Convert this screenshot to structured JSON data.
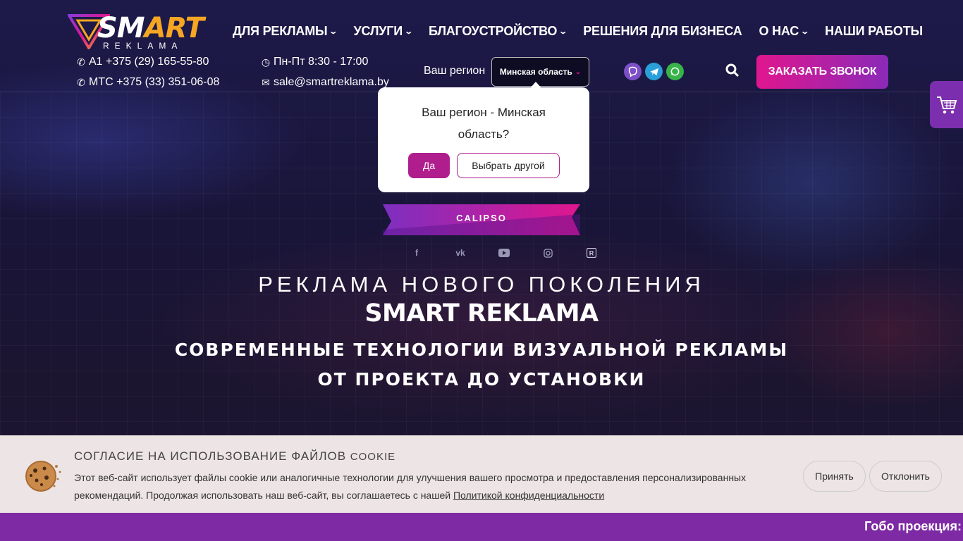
{
  "brand": {
    "logo_main_a": "SM",
    "logo_main_b": "ART",
    "logo_sub": "REKLAMA"
  },
  "nav": [
    {
      "label": "ДЛЯ РЕКЛАМЫ",
      "has_dropdown": true
    },
    {
      "label": "УСЛУГИ",
      "has_dropdown": true
    },
    {
      "label": "БЛАГОУСТРОЙСТВО",
      "has_dropdown": true
    },
    {
      "label": "РЕШЕНИЯ ДЛЯ БИЗНЕСА",
      "has_dropdown": false
    },
    {
      "label": "О НАС",
      "has_dropdown": true
    },
    {
      "label": "НАШИ РАБОТЫ",
      "has_dropdown": false
    }
  ],
  "contacts": {
    "phone_a1": "A1 +375 (29) 165-55-80",
    "phone_mts": "МТС +375 (33) 351-06-08",
    "hours": "Пн-Пт 8:30 - 17:00",
    "email": "sale@smartreklama.by"
  },
  "region": {
    "label": "Ваш регион",
    "selected": "Минская область"
  },
  "messengers": [
    "viber-icon",
    "telegram-icon",
    "whatsapp-icon"
  ],
  "call_button": "ЗАКАЗАТЬ ЗВОНОК",
  "popup": {
    "text": "Ваш регион - Минская область?",
    "yes": "Да",
    "other": "Выбрать другой"
  },
  "hero": {
    "ribbon": "CALIPSO",
    "socials": [
      "facebook-icon",
      "vk-icon",
      "youtube-icon",
      "instagram-icon",
      "rutube-icon"
    ],
    "line1": "РЕКЛАМА НОВОГО ПОКОЛЕНИЯ",
    "line2": "SMART REKLAMA",
    "line3": "СОВРЕМЕННЫЕ ТЕХНОЛОГИИ ВИЗУАЛЬНОЙ РЕКЛАМЫ",
    "line4": "ОТ ПРОЕКТА ДО УСТАНОВКИ"
  },
  "cookie": {
    "title": "СОГЛАСИЕ НА ИСПОЛЬЗОВАНИЕ ФАЙЛОВ",
    "title_suffix": "COOKIE",
    "text": "Этот веб-сайт использует файлы cookie или аналогичные технологии для улучшения вашего просмотра и предоставления персонализированных рекомендаций. Продолжая использовать наш веб-сайт, вы соглашаетесь с нашей",
    "link": "Политикой конфиденциальности",
    "accept": "Принять",
    "decline": "Отклонить"
  },
  "bottom_bar": {
    "text": "Гобо проекция:"
  },
  "colors": {
    "accent_pink": "#e0168e",
    "accent_purple": "#7e2aa5",
    "logo_orange": "#f6a623"
  }
}
